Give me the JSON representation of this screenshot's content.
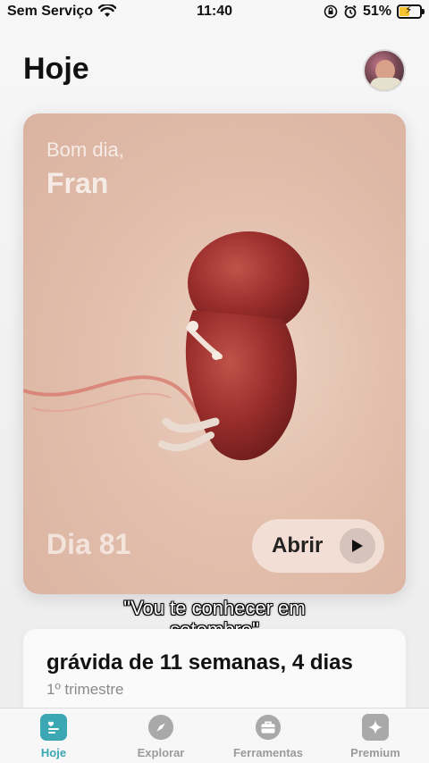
{
  "status_bar": {
    "carrier": "Sem Serviço",
    "time": "11:40",
    "battery": "51%",
    "battery_level": 0.51
  },
  "header": {
    "title": "Hoje"
  },
  "hero": {
    "greeting": "Bom dia,",
    "name": "Fran",
    "day": "Dia 81",
    "open_label": "Abrir"
  },
  "caption": {
    "line1": "\"Vou te conhecer em",
    "line2": "setembro\""
  },
  "pregnancy": {
    "title": "grávida de 11 semanas, 4 dias",
    "trimester": "1º trimestre"
  },
  "tabs": [
    {
      "label": "Hoje",
      "icon": "today-icon",
      "active": true
    },
    {
      "label": "Explorar",
      "icon": "compass-icon",
      "active": false
    },
    {
      "label": "Ferramentas",
      "icon": "briefcase-icon",
      "active": false
    },
    {
      "label": "Premium",
      "icon": "sparkle-icon",
      "active": false
    }
  ],
  "colors": {
    "accent": "#3aa7b3",
    "hero_bg": "#e3bfad",
    "tab_inactive": "#9b9b9b"
  }
}
